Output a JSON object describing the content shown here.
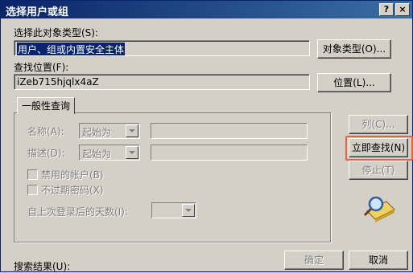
{
  "window": {
    "title": "选择用户或组",
    "help": "?",
    "close": "×"
  },
  "object_type": {
    "label": "选择此对象类型(S):",
    "value": "用户、组或内置安全主体",
    "button": "对象类型(O)..."
  },
  "location": {
    "label": "查找位置(F):",
    "value": "iZeb715hjqlx4aZ",
    "button": "位置(L)..."
  },
  "tab": {
    "label": "一般性查询"
  },
  "query": {
    "name_label": "名称(A):",
    "name_mode": "起始为",
    "desc_label": "描述(D):",
    "desc_mode": "起始为",
    "disabled_accounts": "禁用的帐户(B)",
    "no_expire_pwd": "不过期密码(X)",
    "days_label": "自上次登录后的天数(I):"
  },
  "side_buttons": {
    "columns": "列(C)...",
    "find_now": "立即查找(N)",
    "stop": "停止(T)"
  },
  "bottom": {
    "results_label": "搜索结果(U):",
    "ok": "确定",
    "cancel": "取消"
  },
  "colors": {
    "highlight": "#e8623a",
    "titlebar": "#0a246a"
  },
  "icons": {
    "search_graphic": "search-magnifier-icon"
  }
}
